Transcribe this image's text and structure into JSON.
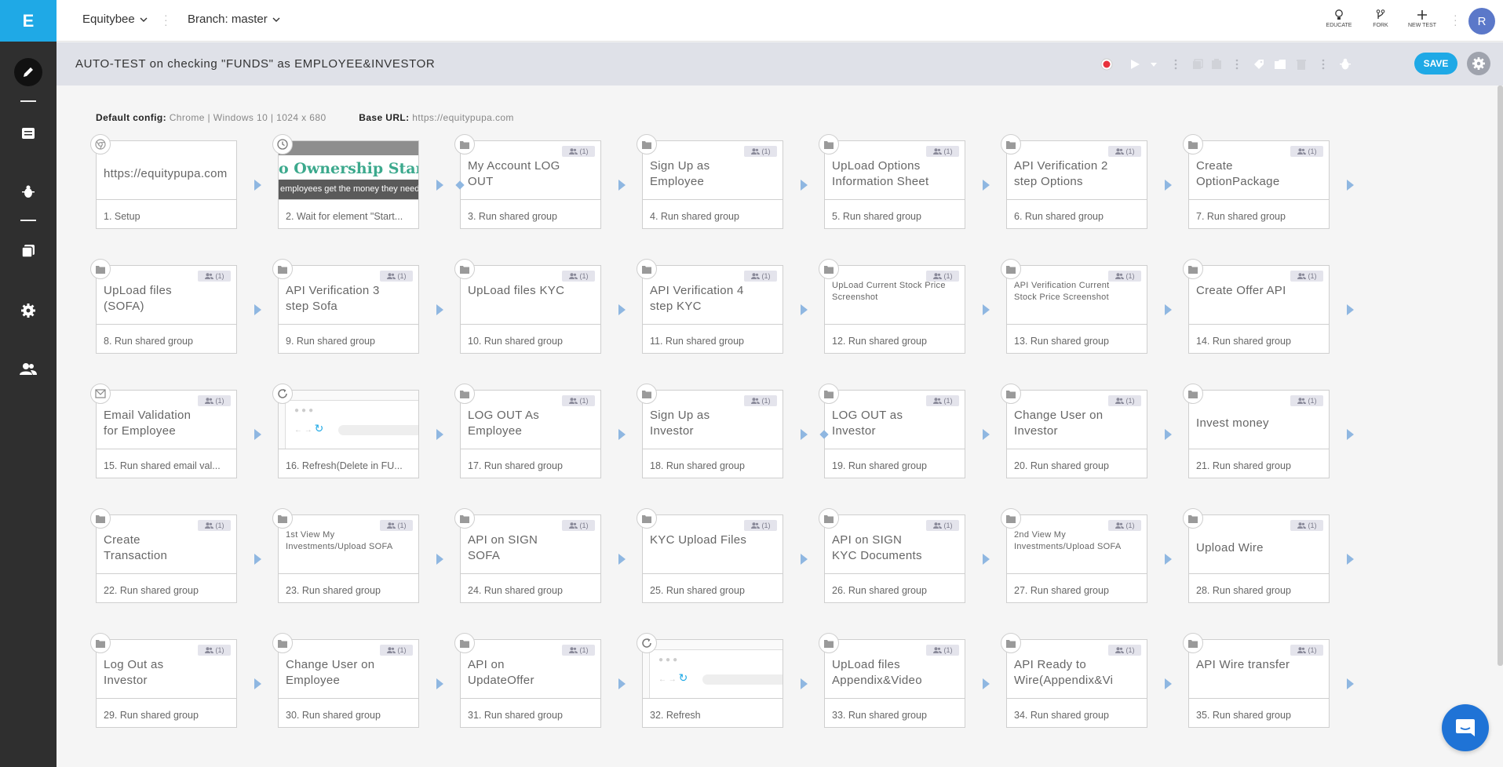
{
  "app": {
    "logo_letter": "E"
  },
  "topbar": {
    "project": "Equitybee",
    "branch": "Branch: master",
    "actions": [
      {
        "label": "EDUCATE",
        "icon": "lightbulb-icon"
      },
      {
        "label": "FORK",
        "icon": "fork-icon"
      },
      {
        "label": "NEW TEST",
        "icon": "plus-icon"
      }
    ],
    "avatar": "R"
  },
  "testbar": {
    "title": "AUTO-TEST on checking \"FUNDS\" as EMPLOYEE&INVESTOR",
    "save_label": "SAVE"
  },
  "config": {
    "default_label": "Default config:",
    "default_value": "Chrome | Windows 10 | 1024 x 680",
    "base_label": "Base URL:",
    "base_value": "https://equitypupa.com"
  },
  "badge_text": "(1)",
  "steps": [
    {
      "title": "https://equitypupa.com",
      "label": "1. Setup",
      "icon": "chrome",
      "kind": "url"
    },
    {
      "title": "",
      "label": "2. Wait for element \"Start...",
      "icon": "clock",
      "kind": "banner",
      "banner_text": "o Ownership Star",
      "banner_sub": "employees get the money they need"
    },
    {
      "title": "My Account LOG OUT",
      "label": "3. Run shared group",
      "icon": "folder",
      "kind": "group"
    },
    {
      "title": "Sign Up as Employee",
      "label": "4. Run shared group",
      "icon": "folder",
      "kind": "group"
    },
    {
      "title": "UpLoad Options Information Sheet",
      "label": "5. Run shared group",
      "icon": "folder",
      "kind": "group"
    },
    {
      "title": "API Verification 2 step Options",
      "label": "6. Run shared group",
      "icon": "folder",
      "kind": "group"
    },
    {
      "title": "Create OptionPackage API",
      "label": "7. Run shared group",
      "icon": "folder",
      "kind": "group"
    },
    {
      "title": "UpLoad files (SOFA)",
      "label": "8. Run shared group",
      "icon": "folder",
      "kind": "group"
    },
    {
      "title": "API Verification 3 step Sofa",
      "label": "9. Run shared group",
      "icon": "folder",
      "kind": "group"
    },
    {
      "title": "UpLoad files KYC",
      "label": "10. Run shared group",
      "icon": "folder",
      "kind": "group"
    },
    {
      "title": "API Verification 4 step KYC",
      "label": "11. Run shared group",
      "icon": "folder",
      "kind": "group"
    },
    {
      "title": "UpLoad Current Stock Price Screenshot",
      "label": "12. Run shared group",
      "icon": "folder",
      "kind": "group",
      "small": true
    },
    {
      "title": "API Verification Current Stock Price Screenshot",
      "label": "13. Run shared group",
      "icon": "folder",
      "kind": "group",
      "small": true
    },
    {
      "title": "Create Offer API",
      "label": "14. Run shared group",
      "icon": "folder",
      "kind": "group"
    },
    {
      "title": "Email Validation for Employee",
      "label": "15. Run shared email val...",
      "icon": "email",
      "kind": "group"
    },
    {
      "title": "",
      "label": "16. Refresh(Delete in FU...",
      "icon": "refresh",
      "kind": "browser"
    },
    {
      "title": "LOG OUT As Employee",
      "label": "17. Run shared group",
      "icon": "folder",
      "kind": "group"
    },
    {
      "title": "Sign Up as Investor",
      "label": "18. Run shared group",
      "icon": "folder",
      "kind": "group"
    },
    {
      "title": "LOG OUT as Investor",
      "label": "19. Run shared group",
      "icon": "folder",
      "kind": "group"
    },
    {
      "title": "Change User on Investor",
      "label": "20. Run shared group",
      "icon": "folder",
      "kind": "group"
    },
    {
      "title": "Invest money",
      "label": "21. Run shared group",
      "icon": "folder",
      "kind": "group",
      "single": true
    },
    {
      "title": "Create Transaction",
      "label": "22. Run shared group",
      "icon": "folder",
      "kind": "group"
    },
    {
      "title": "1st View My Investments/Upload SOFA",
      "label": "23. Run shared group",
      "icon": "folder",
      "kind": "group",
      "small": true
    },
    {
      "title": "API on SIGN SOFA",
      "label": "24. Run shared group",
      "icon": "folder",
      "kind": "group"
    },
    {
      "title": "KYC Upload Files",
      "label": "25. Run shared group",
      "icon": "folder",
      "kind": "group"
    },
    {
      "title": "API on SIGN KYC Documents",
      "label": "26. Run shared group",
      "icon": "folder",
      "kind": "group"
    },
    {
      "title": "2nd View My Investments/Upload SOFA",
      "label": "27. Run shared group",
      "icon": "folder",
      "kind": "group",
      "small": true
    },
    {
      "title": "Upload Wire",
      "label": "28. Run shared group",
      "icon": "folder",
      "kind": "group",
      "single": true
    },
    {
      "title": "Log Out as Investor",
      "label": "29. Run shared group",
      "icon": "folder",
      "kind": "group"
    },
    {
      "title": "Change User on Employee",
      "label": "30. Run shared group",
      "icon": "folder",
      "kind": "group"
    },
    {
      "title": "API on UpdateOffer",
      "label": "31. Run shared group",
      "icon": "folder",
      "kind": "group"
    },
    {
      "title": "",
      "label": "32. Refresh",
      "icon": "refresh",
      "kind": "browser"
    },
    {
      "title": "UpLoad files Appendix&Video",
      "label": "33. Run shared group",
      "icon": "folder",
      "kind": "group"
    },
    {
      "title": "API Ready to Wire(Appendix&Vid...",
      "label": "34. Run shared group",
      "icon": "folder",
      "kind": "group"
    },
    {
      "title": "API Wire transfer",
      "label": "35. Run shared group",
      "icon": "folder",
      "kind": "group"
    }
  ],
  "diamond_steps": [
    3,
    19
  ]
}
